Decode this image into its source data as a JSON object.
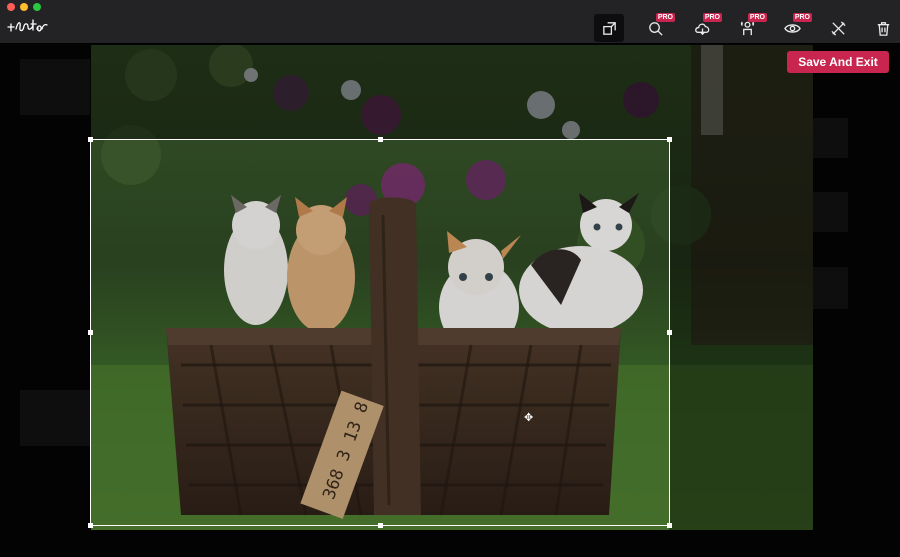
{
  "app": {
    "logo_text": "Fotor"
  },
  "toolbar": {
    "tools": [
      {
        "name": "crop",
        "icon": "crop-icon",
        "pro": false,
        "active": true
      },
      {
        "name": "magic-search",
        "icon": "magnifier-icon",
        "pro": true,
        "pro_label": "PRO"
      },
      {
        "name": "cloud-enhance",
        "icon": "cloud-icon",
        "pro": true,
        "pro_label": "PRO"
      },
      {
        "name": "ai-tool",
        "icon": "person-icon",
        "pro": true,
        "pro_label": "PRO"
      },
      {
        "name": "preview",
        "icon": "eye-icon",
        "pro": true,
        "pro_label": "PRO"
      },
      {
        "name": "tools",
        "icon": "wrench-ruler-icon",
        "pro": false
      },
      {
        "name": "delete",
        "icon": "trash-icon",
        "pro": false
      }
    ]
  },
  "actions": {
    "save_label": "Save And Exit"
  },
  "image": {
    "tag_text": "368 3 13 8"
  },
  "colors": {
    "accent": "#c8264f",
    "titlebar": "#232325",
    "canvas": "#030303"
  }
}
